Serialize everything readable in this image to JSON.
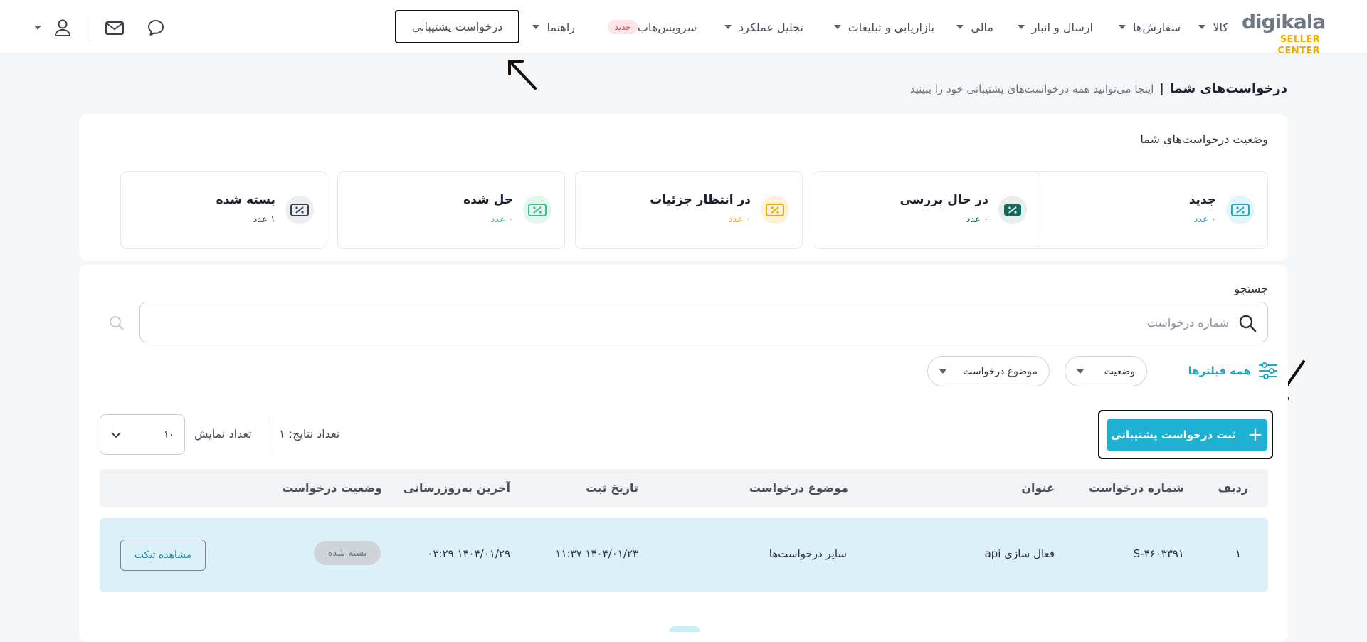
{
  "brand": {
    "wordmark": "digikala",
    "subtitle": "SELLER CENTER",
    "color": "#f2a900"
  },
  "nav": {
    "items": [
      {
        "label": "کالا"
      },
      {
        "label": "سفارش‌ها"
      },
      {
        "label": "ارسال و انبار"
      },
      {
        "label": "مالی"
      },
      {
        "label": "بازاریابی و تبلیغات"
      },
      {
        "label": "تحلیل عملکرد"
      },
      {
        "label": "سرویس‌هاب",
        "badge": "جدید"
      },
      {
        "label": "راهنما"
      }
    ],
    "active": "درخواست پشتیبانی",
    "icons": [
      "chat-icon",
      "mail-icon",
      "user-icon"
    ]
  },
  "page": {
    "title": "درخواست‌های شما",
    "separator": "|",
    "subtitle": "اینجا می‌توانید همه درخواست‌های پشتیبانی خود را ببینید"
  },
  "status": {
    "title": "وضعیت درخواست‌های شما",
    "cards": [
      {
        "label": "جدید",
        "count": "۰ عدد",
        "color": "#1fa7c7"
      },
      {
        "label": "در حال بررسی",
        "count": "۰ عدد",
        "color": "#0f6b5a"
      },
      {
        "label": "در انتظار جزئیات",
        "count": "۰ عدد",
        "color": "#f2a900"
      },
      {
        "label": "حل شده",
        "count": "۰ عدد",
        "color": "#3dbd8a"
      },
      {
        "label": "بسته شده",
        "count": "۱ عدد",
        "color": "#3a3f4a"
      }
    ]
  },
  "search": {
    "label": "جستجو",
    "placeholder": "شماره درخواست"
  },
  "filters": {
    "all_label": "همه فیلترها",
    "status_label": "وضعیت",
    "subject_label": "موضوع درخواست"
  },
  "actions": {
    "add_label": "ثبت درخواست پشتیبانی",
    "results_label": "تعداد نتایج: ۱",
    "show_label": "تعداد نمایش",
    "per_page": "۱۰"
  },
  "table": {
    "headers": {
      "row": "ردیف",
      "number": "شماره درخواست",
      "title": "عنوان",
      "subject": "موضوع درخواست",
      "created": "تاریخ ثبت",
      "updated": "آخرین به‌روزرسانی",
      "status": "وضعیت درخواست"
    },
    "rows": [
      {
        "row": "۱",
        "number": "S-۴۶۰۳۳۹۱",
        "title": "فعال سازی api",
        "subject": "سایر درخواست‌ها",
        "created": "۱۱:۳۷ ۱۴۰۴/۰۱/۲۳",
        "updated": "۰۳:۲۹ ۱۴۰۴/۰۱/۲۹",
        "status": "بسته شده",
        "action": "مشاهده تیکت"
      }
    ]
  }
}
